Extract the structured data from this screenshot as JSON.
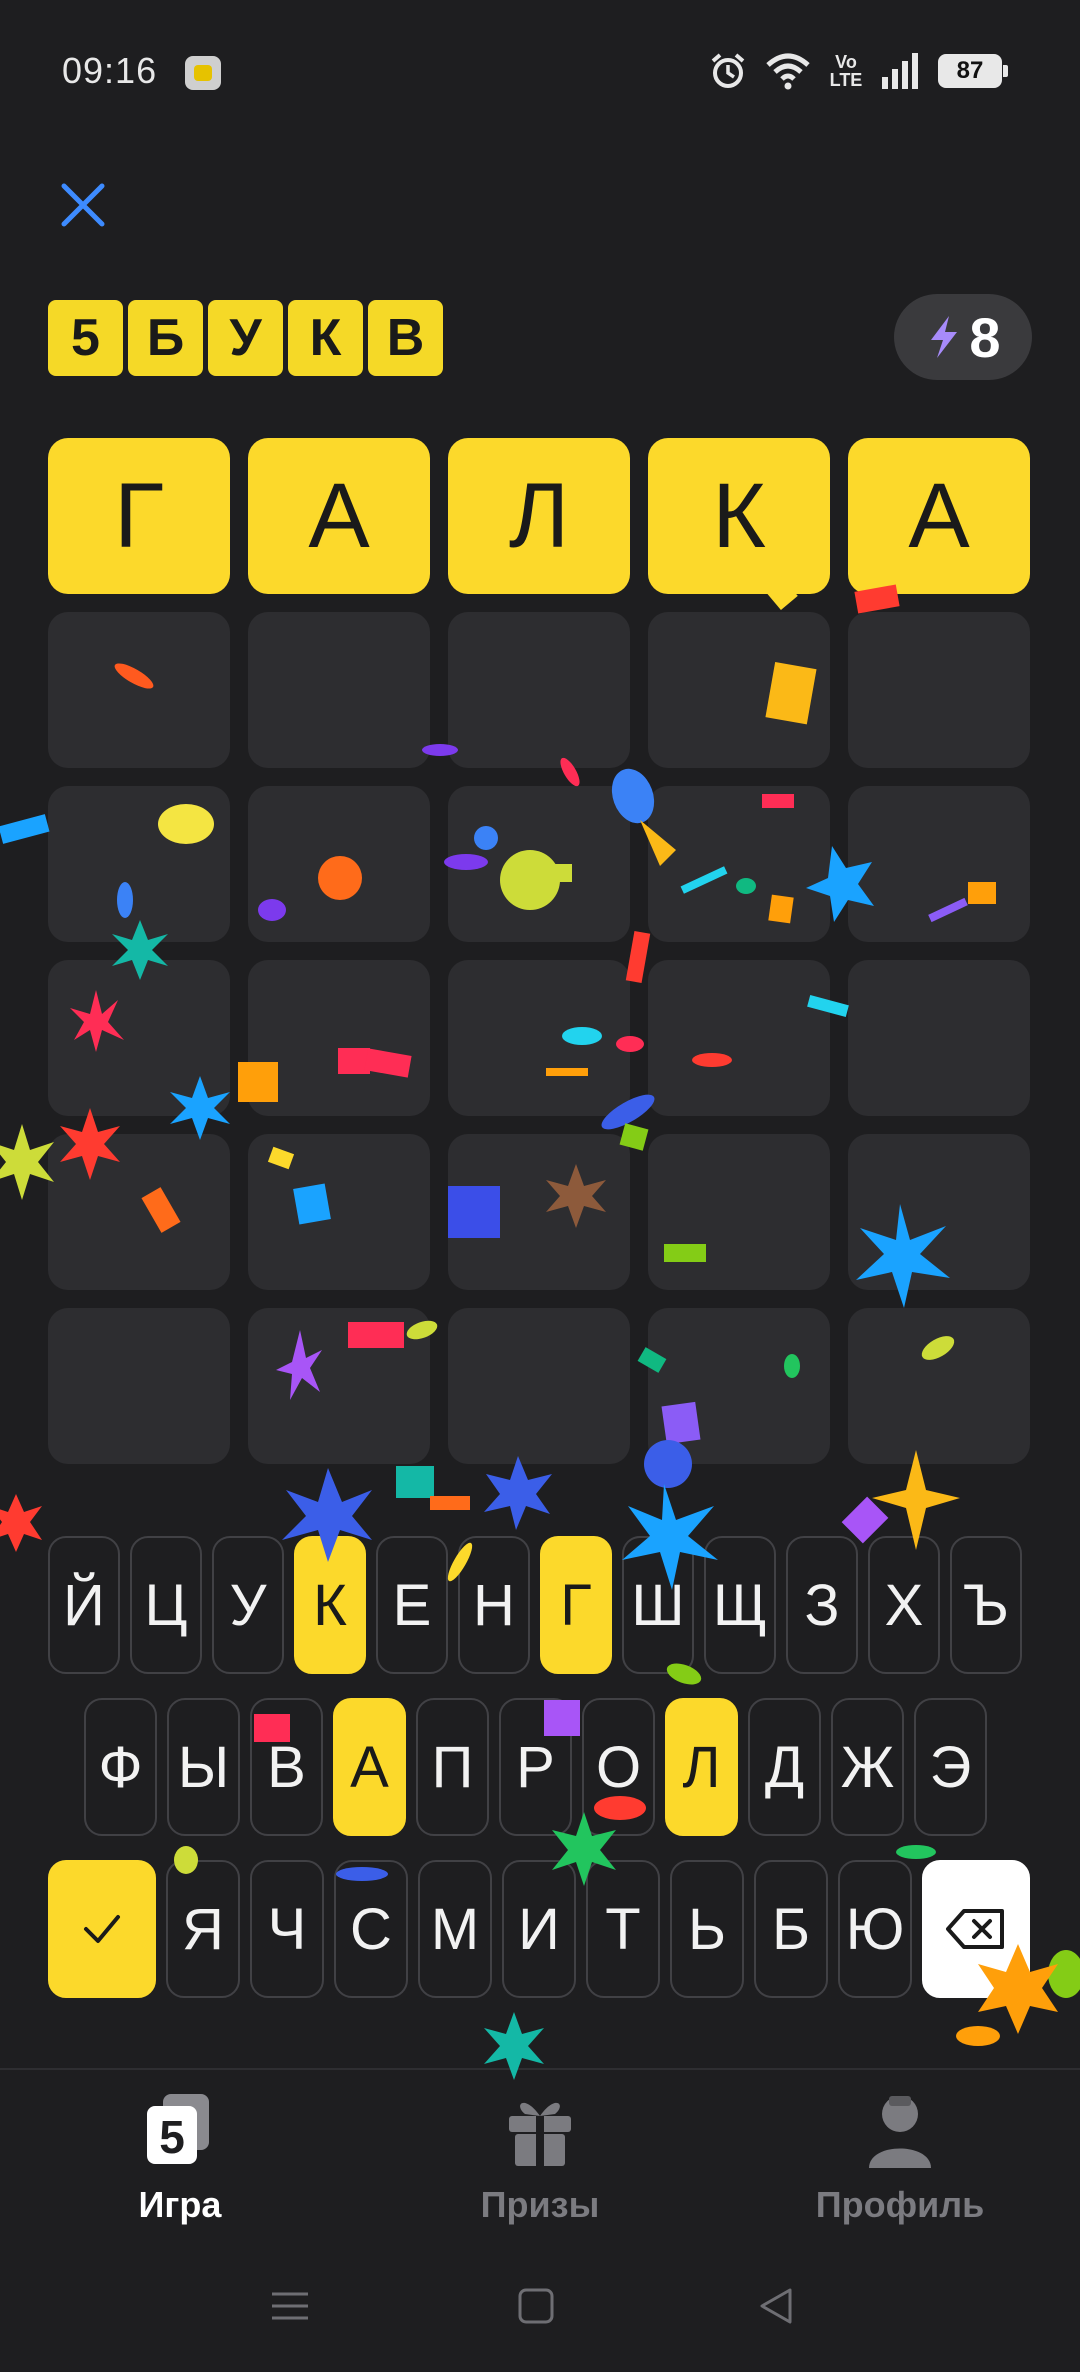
{
  "status_bar": {
    "time": "09:16",
    "network": "Vo LTE",
    "battery": "87"
  },
  "title_letters": [
    "5",
    "Б",
    "У",
    "К",
    "В"
  ],
  "energy": {
    "count": "8"
  },
  "grid": {
    "rows": [
      [
        "Г",
        "А",
        "Л",
        "К",
        "А"
      ],
      [
        "",
        "",
        "",
        "",
        ""
      ],
      [
        "",
        "",
        "",
        "",
        ""
      ],
      [
        "",
        "",
        "",
        "",
        ""
      ],
      [
        "",
        "",
        "",
        "",
        ""
      ],
      [
        "",
        "",
        "",
        "",
        ""
      ]
    ]
  },
  "keyboard": {
    "row1": [
      "Й",
      "Ц",
      "У",
      "К",
      "Е",
      "Н",
      "Г",
      "Ш",
      "Щ",
      "З",
      "Х",
      "Ъ"
    ],
    "row2": [
      "Ф",
      "Ы",
      "В",
      "А",
      "П",
      "Р",
      "О",
      "Л",
      "Д",
      "Ж",
      "Э"
    ],
    "row3": [
      "Я",
      "Ч",
      "С",
      "М",
      "И",
      "Т",
      "Ь",
      "Б",
      "Ю"
    ],
    "highlighted": [
      "К",
      "Г",
      "А",
      "Л"
    ]
  },
  "bottom_nav": {
    "tabs": [
      {
        "label": "Игра",
        "icon": "game-icon",
        "active": true
      },
      {
        "label": "Призы",
        "icon": "gift-icon",
        "active": false
      },
      {
        "label": "Профиль",
        "icon": "profile-icon",
        "active": false
      }
    ]
  },
  "colors": {
    "accent": "#fcd92b",
    "background": "#1e1e20",
    "cell": "#2d2d30"
  }
}
